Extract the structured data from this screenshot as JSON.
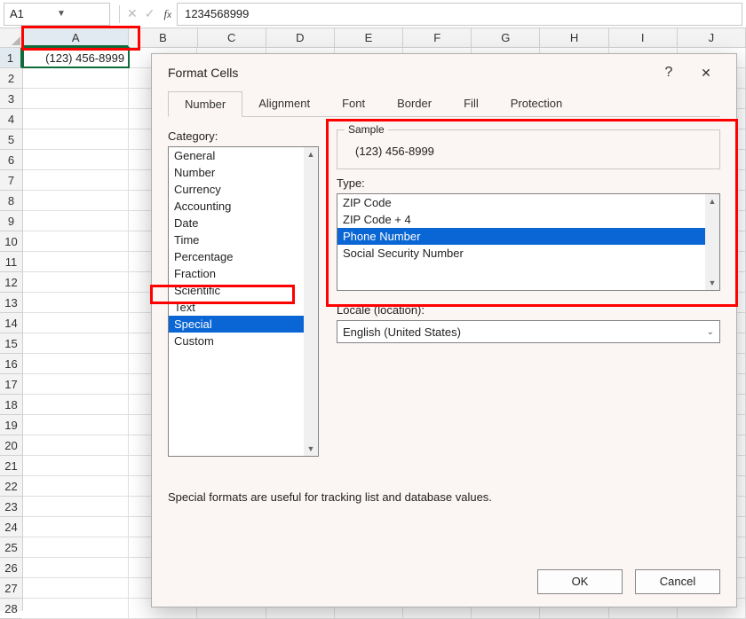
{
  "formula_bar": {
    "cell_ref": "A1",
    "value": "1234568999"
  },
  "grid": {
    "columns": [
      "A",
      "B",
      "C",
      "D",
      "E",
      "F",
      "G",
      "H",
      "I",
      "J"
    ],
    "rows": 28,
    "a1_display": "(123) 456-8999"
  },
  "dialog": {
    "title": "Format Cells",
    "tabs": [
      "Number",
      "Alignment",
      "Font",
      "Border",
      "Fill",
      "Protection"
    ],
    "active_tab": "Number",
    "category_label": "Category:",
    "categories": [
      "General",
      "Number",
      "Currency",
      "Accounting",
      "Date",
      "Time",
      "Percentage",
      "Fraction",
      "Scientific",
      "Text",
      "Special",
      "Custom"
    ],
    "selected_category": "Special",
    "sample_label": "Sample",
    "sample_value": "(123) 456-8999",
    "type_label": "Type:",
    "types": [
      "ZIP Code",
      "ZIP Code + 4",
      "Phone Number",
      "Social Security Number"
    ],
    "selected_type": "Phone Number",
    "locale_label": "Locale (location):",
    "locale_value": "English (United States)",
    "description": "Special formats are useful for tracking list and database values.",
    "ok": "OK",
    "cancel": "Cancel"
  }
}
